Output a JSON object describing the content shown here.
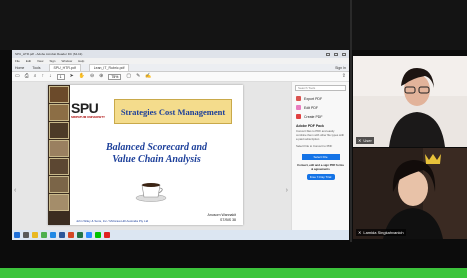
{
  "window": {
    "title": "SPU_HTR.pdf - Adobe Acrobat Reader DC (64-bit)",
    "menu": [
      "File",
      "Edit",
      "View",
      "Sign",
      "Window",
      "Help"
    ],
    "tabs": [
      "Home",
      "Tools",
      "SPU_HTR.pdf",
      "Lean_IT_Rubric.pdf"
    ],
    "sign_in": "Sign In"
  },
  "toolbar": {
    "page": "1",
    "zoom": "75%"
  },
  "slide": {
    "logo": "SPU",
    "logo_sub": "SRIPATUM UNIVERSITY",
    "banner": "Strategies Cost Management",
    "title_line1": "Balanced Scorecard and",
    "title_line2": "Value Chain Analysis",
    "author_name": "Anusorn Wannakit",
    "author_code": "ST/BIS 38",
    "publisher": "John Wiley & Sons, Inc / McGraw-Hill Australia Pty Ltd"
  },
  "panel": {
    "search": "Search Tools",
    "items": [
      "Export PDF",
      "Edit PDF",
      "Create PDF"
    ],
    "pack_title": "Adobe PDF Pack",
    "pack_text": "Convert files to PDF and easily combine them with other file types with a paid subscription",
    "convert_link": "Select File to Convert to PDF",
    "button": "Select File",
    "promo": "Convert, edit and e-sign PDF forms & agreements",
    "trial": "Free 7-Day Trial"
  },
  "participants": [
    {
      "name": "User"
    },
    {
      "name": "Lamida Singkahvanich"
    }
  ],
  "colors": {
    "banner_bg": "#f4dc8c",
    "title_blue": "#1c3f9a",
    "acrobat_blue": "#1473e6",
    "bottom_bar": "#3cc43c"
  }
}
